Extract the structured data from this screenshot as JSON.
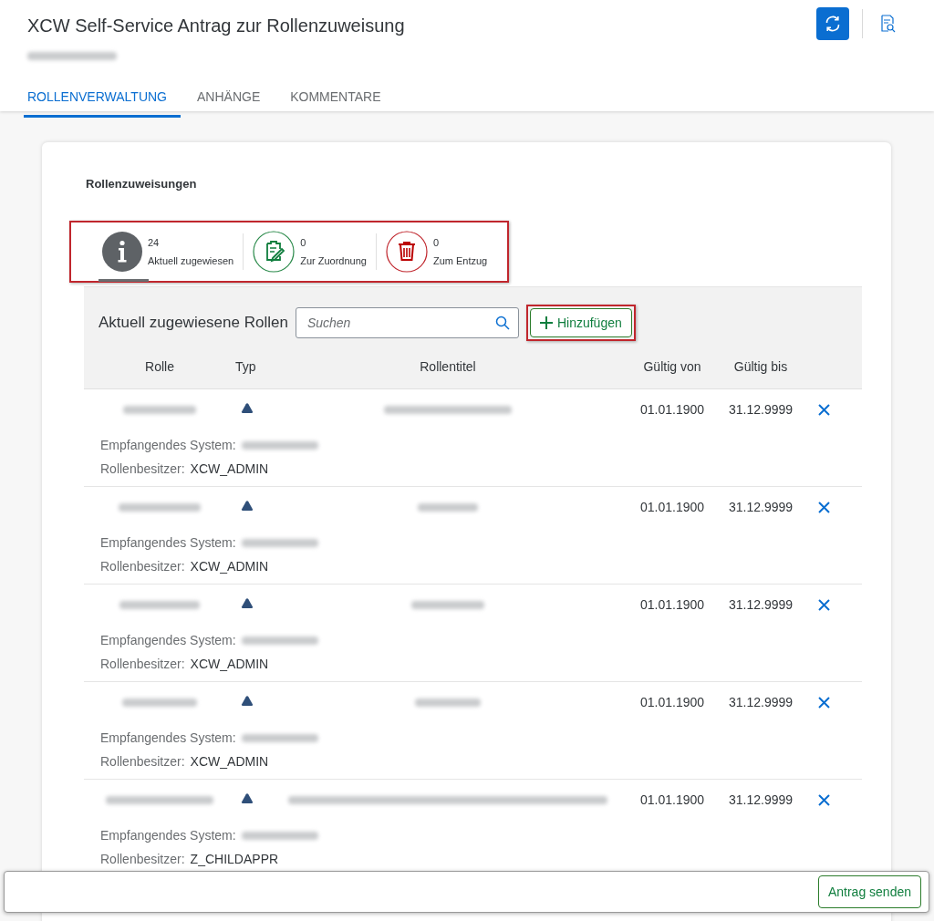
{
  "header": {
    "title": "XCW Self-Service Antrag zur Rollenzuweisung"
  },
  "tabs": [
    {
      "label": "ROLLENVERWALTUNG",
      "selected": true
    },
    {
      "label": "ANHÄNGE",
      "selected": false
    },
    {
      "label": "KOMMENTARE",
      "selected": false
    }
  ],
  "section": {
    "title": "Rollenzuweisungen"
  },
  "kpis": [
    {
      "kind": "info",
      "count": "24",
      "label": "Aktuell zugewiesen",
      "selected": true
    },
    {
      "kind": "assign",
      "count": "0",
      "label": "Zur Zuordnung",
      "selected": false
    },
    {
      "kind": "revoke",
      "count": "0",
      "label": "Zum Entzug",
      "selected": false
    }
  ],
  "table": {
    "title": "Aktuell zugewiesene Rollen",
    "search": {
      "placeholder": "Suchen"
    },
    "add_button": "Hinzufügen",
    "columns": [
      "Rolle",
      "Typ",
      "Rollentitel",
      "Gültig von",
      "Gültig bis"
    ],
    "rows": [
      {
        "valid_from": "01.01.1900",
        "valid_to": "31.12.9999",
        "system_label": "Empfangendes System:",
        "owner_label": "Rollenbesitzer:",
        "owner": "XCW_ADMIN"
      },
      {
        "valid_from": "01.01.1900",
        "valid_to": "31.12.9999",
        "system_label": "Empfangendes System:",
        "owner_label": "Rollenbesitzer:",
        "owner": "XCW_ADMIN"
      },
      {
        "valid_from": "01.01.1900",
        "valid_to": "31.12.9999",
        "system_label": "Empfangendes System:",
        "owner_label": "Rollenbesitzer:",
        "owner": "XCW_ADMIN"
      },
      {
        "valid_from": "01.01.1900",
        "valid_to": "31.12.9999",
        "system_label": "Empfangendes System:",
        "owner_label": "Rollenbesitzer:",
        "owner": "XCW_ADMIN"
      },
      {
        "valid_from": "01.01.1900",
        "valid_to": "31.12.9999",
        "system_label": "Empfangendes System:",
        "owner_label": "Rollenbesitzer:",
        "owner": "Z_CHILDAPPR"
      }
    ]
  },
  "footer": {
    "submit_button": "Antrag senden"
  }
}
